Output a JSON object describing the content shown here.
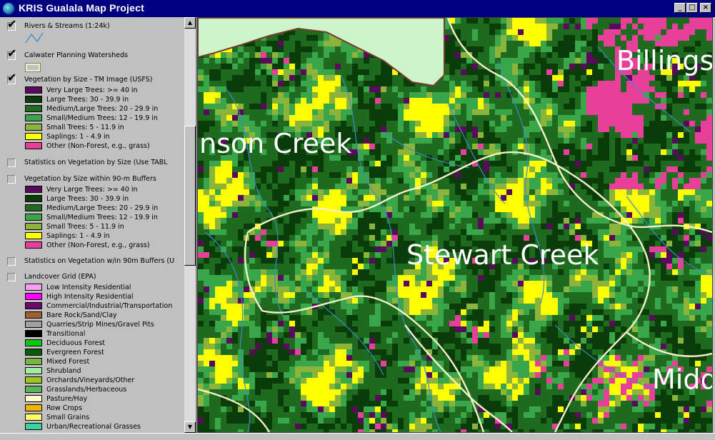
{
  "window": {
    "title": "KRIS Gualala Map Project",
    "minimize_label": "_",
    "maximize_label": "□",
    "close_label": "×"
  },
  "legend": {
    "layers": [
      {
        "name": "Rivers & Streams (1:24k)",
        "checked": true,
        "items": []
      },
      {
        "name": "Calwater Planning Watersheds",
        "checked": true,
        "items": []
      },
      {
        "name": "Vegetation by Size - TM Image (USFS)",
        "checked": true,
        "items": [
          {
            "label": "Very Large Trees: >= 40  in",
            "color": "#5a0a5a"
          },
          {
            "label": "Large Trees: 30 - 39.9  in",
            "color": "#0a3c0a"
          },
          {
            "label": "Medium/Large Trees: 20 - 29.9 in",
            "color": "#1e6a1e"
          },
          {
            "label": "Small/Medium Trees: 12 - 19.9 in",
            "color": "#3aa64a"
          },
          {
            "label": "Small Trees: 5 - 11.9 in",
            "color": "#8cb43a"
          },
          {
            "label": "Saplings: 1 - 4.9 in",
            "color": "#ffff00"
          },
          {
            "label": "Other (Non-Forest, e.g., grass)",
            "color": "#e8409a"
          }
        ]
      },
      {
        "name": "Statistics on Vegetation by Size (Use TABL",
        "checked": false,
        "items": []
      },
      {
        "name": "Vegetation by Size within 90-m Buffers",
        "checked": false,
        "items": [
          {
            "label": "Very Large Trees: >= 40  in",
            "color": "#5a0a5a"
          },
          {
            "label": "Large Trees: 30 - 39.9  in",
            "color": "#0a3c0a"
          },
          {
            "label": "Medium/Large Trees: 20 - 29.9 in",
            "color": "#1e6a1e"
          },
          {
            "label": "Small/Medium Trees: 12 - 19.9 in",
            "color": "#3aa64a"
          },
          {
            "label": "Small Trees: 5 - 11.9 in",
            "color": "#8cb43a"
          },
          {
            "label": "Saplings: 1 - 4.9 in",
            "color": "#ffff00"
          },
          {
            "label": "Other (Non-Forest, e.g., grass)",
            "color": "#e8409a"
          }
        ]
      },
      {
        "name": "Statistics on Vegetation w/in 90m Buffers (U",
        "checked": false,
        "items": []
      },
      {
        "name": "Landcover Grid (EPA)",
        "checked": false,
        "items": [
          {
            "label": "Low Intensity Residential",
            "color": "#f5a0f5"
          },
          {
            "label": "High Intensity Residential",
            "color": "#ff00ff"
          },
          {
            "label": "Commercial/Industrial/Transportation",
            "color": "#6a0a6a"
          },
          {
            "label": "Bare Rock/Sand/Clay",
            "color": "#a0602a"
          },
          {
            "label": "Quarries/Strip Mines/Gravel Pits",
            "color": "#a0a0a0"
          },
          {
            "label": "Transitional",
            "color": "#000000"
          },
          {
            "label": "Deciduous Forest",
            "color": "#0ac80a"
          },
          {
            "label": "Evergreen Forest",
            "color": "#0a5a0a"
          },
          {
            "label": "Mixed Forest",
            "color": "#7ab43a"
          },
          {
            "label": "Shrubland",
            "color": "#a0f0a0"
          },
          {
            "label": "Orchards/Vineyards/Other",
            "color": "#9ac81a"
          },
          {
            "label": "Grasslands/Herbaceous",
            "color": "#5ab45a"
          },
          {
            "label": "Pasture/Hay",
            "color": "#ffffc8"
          },
          {
            "label": "Row Crops",
            "color": "#f0b400"
          },
          {
            "label": "Small Grains",
            "color": "#ffff64"
          },
          {
            "label": "Urban/Recreational Grasses",
            "color": "#3ad2a0"
          }
        ]
      }
    ]
  },
  "map": {
    "labels": [
      {
        "text": "nson Creek"
      },
      {
        "text": "Billings"
      },
      {
        "text": "Stewart Creek"
      },
      {
        "text": "Midd"
      }
    ],
    "colors": {
      "water": "#ccf5cc",
      "river": "#3c8cc8",
      "watershed_boundary": "#f5f0c8"
    }
  }
}
